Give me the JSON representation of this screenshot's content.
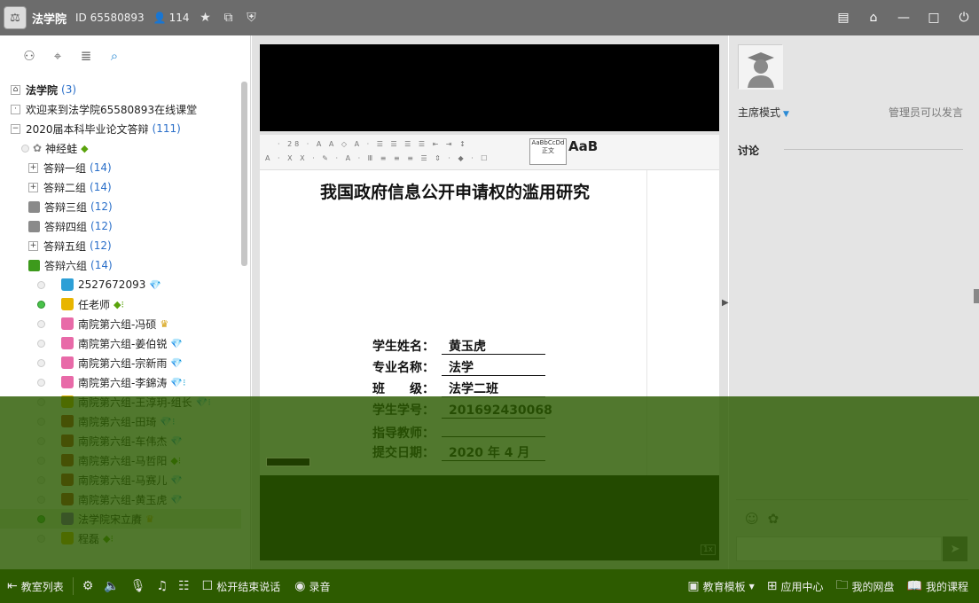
{
  "titlebar": {
    "room_name": "法学院",
    "room_id": "ID 65580893",
    "user_count": "114",
    "icons": [
      "star-icon",
      "share-icon",
      "shield-icon"
    ],
    "window_icons": [
      "notes-icon",
      "home-icon",
      "minimize-icon",
      "maximize-icon",
      "power-icon"
    ]
  },
  "left_tabs": [
    "member-icon",
    "location-icon",
    "list-icon",
    "search-icon"
  ],
  "tree": {
    "root": {
      "label": "法学院",
      "count": "(3)"
    },
    "welcome": "欢迎来到法学院65580893在线课堂",
    "channel": {
      "label": "2020届本科毕业论文答辩",
      "count": "(111)"
    },
    "host": "神经蛙",
    "groups": [
      {
        "label": "答辩一组",
        "count": "(14)"
      },
      {
        "label": "答辩二组",
        "count": "(14)"
      },
      {
        "label": "答辩三组",
        "count": "(12)"
      },
      {
        "label": "答辩四组",
        "count": "(12)"
      },
      {
        "label": "答辩五组",
        "count": "(12)"
      },
      {
        "label": "答辩六组",
        "count": "(14)"
      }
    ],
    "members": [
      {
        "name": "2527672093",
        "badge": "💎",
        "online": false,
        "shirt": "#2d9fd6"
      },
      {
        "name": "任老师",
        "badge": "◆⁝",
        "online": true,
        "shirt": "#e8b500"
      },
      {
        "name": "南院第六组-冯硕",
        "badge": "♛",
        "online": false,
        "shirt": "#e86aa8"
      },
      {
        "name": "南院第六组-姜伯锐",
        "badge": "💎",
        "online": false,
        "shirt": "#e86aa8"
      },
      {
        "name": "南院第六组-宗新雨",
        "badge": "💎",
        "online": false,
        "shirt": "#e86aa8"
      },
      {
        "name": "南院第六组-李錦涛",
        "badge": "💎⁝",
        "online": false,
        "shirt": "#e86aa8"
      },
      {
        "name": "南院第六组-王淳玥-组长",
        "badge": "💎⁝",
        "online": false,
        "shirt": "#e8b500"
      },
      {
        "name": "南院第六组-田琦",
        "badge": "💎⁝",
        "online": false,
        "shirt": "#c2281e"
      },
      {
        "name": "南院第六组-车伟杰",
        "badge": "💎",
        "online": false,
        "shirt": "#c2281e"
      },
      {
        "name": "南院第六组-马哲阳",
        "badge": "◆⁝",
        "online": false,
        "shirt": "#c2281e"
      },
      {
        "name": "南院第六组-马赛儿",
        "badge": "💎",
        "online": false,
        "shirt": "#c2281e"
      },
      {
        "name": "南院第六组-黄玉虎",
        "badge": "💎",
        "online": false,
        "shirt": "#c2281e"
      },
      {
        "name": "法学院宋立賡",
        "badge": "♛",
        "online": true,
        "shirt": "#7a3fd0"
      },
      {
        "name": "程磊",
        "badge": "◆⁝",
        "online": false,
        "shirt": "#e8b500"
      }
    ]
  },
  "document": {
    "ribbon_style_label": "正文",
    "ribbon_style_preview": "AaBbCcDd",
    "ribbon_big": "AaB",
    "title": "我国政府信息公开申请权的滥用研究",
    "fields": [
      {
        "label": "学生姓名：",
        "value": "黄玉虎"
      },
      {
        "label": "专业名称：",
        "value": "法学"
      },
      {
        "label": "班　　级：",
        "value": "法学二班"
      },
      {
        "label": "学生学号：",
        "value": "201692430068"
      },
      {
        "label": "指导教师：",
        "value": ""
      },
      {
        "label": "提交日期：",
        "value": "2020 年  4 月"
      }
    ],
    "zoom_indicator": "1x"
  },
  "right_panel": {
    "mode": "主席模式",
    "admin_note": "管理员可以发言",
    "discussion": "讨论",
    "chat_tools": [
      "emoji-icon",
      "flower-icon"
    ],
    "send_icon": "send-icon"
  },
  "bottombar": {
    "classroom_list": "教室列表",
    "push_to_talk": "松开结束说话",
    "record": "录音",
    "edu_template": "教育模板",
    "app_center": "应用中心",
    "my_cloud": "我的网盘",
    "my_course": "我的课程"
  }
}
